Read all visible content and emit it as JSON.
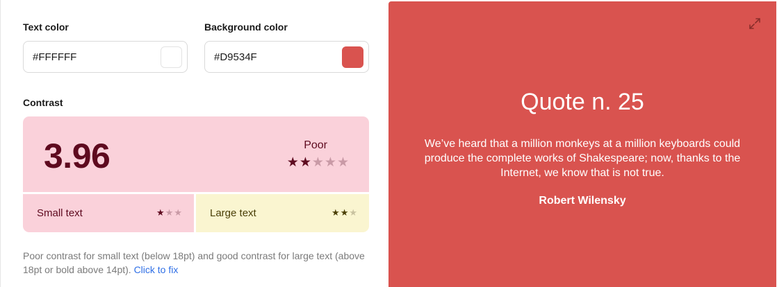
{
  "text_color": {
    "label": "Text color",
    "value": "#FFFFFF",
    "swatch": "#FFFFFF"
  },
  "background_color": {
    "label": "Background color",
    "value": "#D9534F",
    "swatch": "#D9534F"
  },
  "contrast": {
    "label": "Contrast",
    "ratio": "3.96",
    "rating": "Poor",
    "stars_filled": 2,
    "stars_total": 5,
    "small_text": {
      "label": "Small text",
      "stars_filled": 1,
      "stars_total": 3
    },
    "large_text": {
      "label": "Large text",
      "stars_filled": 2,
      "stars_total": 3
    }
  },
  "help": {
    "text": "Poor contrast for small text (below 18pt) and good contrast for large text (above 18pt or bold above 14pt).",
    "fix_link": "Click to fix"
  },
  "preview": {
    "title": "Quote n. 25",
    "quote": "We’ve heard that a million monkeys at a million keyboards could produce the complete works of Shakespeare; now, thanks to the Internet, we know that is not true.",
    "author": "Robert Wilensky",
    "expand_icon": "expand-icon"
  },
  "colors": {
    "poor_bg": "#FAD1DA",
    "poor_fg": "#5E0A1F",
    "poor_star_empty": "#C99AA6",
    "good_bg": "#FAF5D0",
    "good_fg": "#4A3F06",
    "good_star_empty": "#C9C2A0",
    "preview_bg": "#D9534F",
    "preview_fg": "#FFFFFF"
  }
}
